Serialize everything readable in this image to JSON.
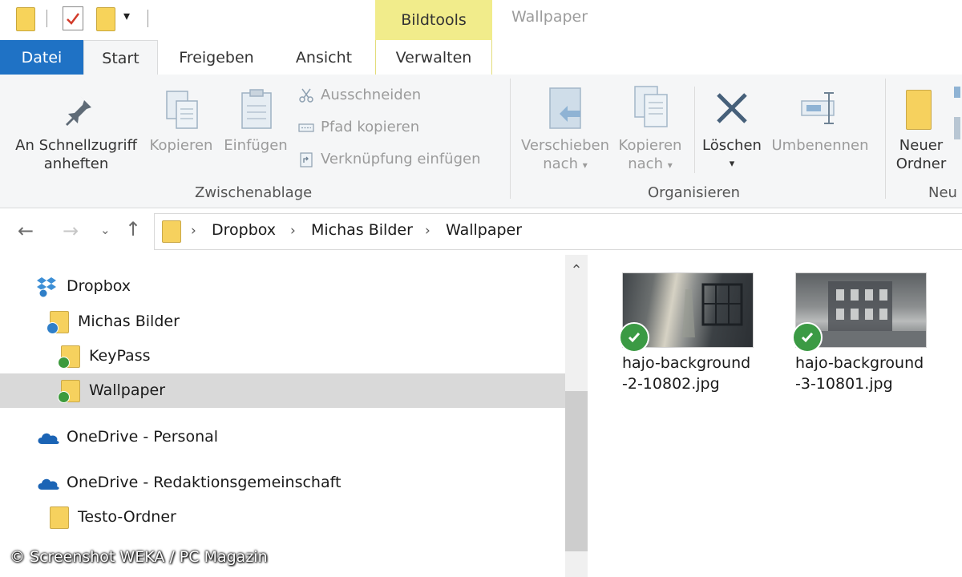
{
  "window": {
    "title": "Wallpaper",
    "context_group": "Bildtools"
  },
  "tabs": {
    "file": "Datei",
    "start": "Start",
    "share": "Freigeben",
    "view": "Ansicht",
    "manage": "Verwalten"
  },
  "ribbon": {
    "pin_line1": "An Schnellzugriff",
    "pin_line2": "anheften",
    "copy": "Kopieren",
    "paste": "Einfügen",
    "cut": "Ausschneiden",
    "copy_path": "Pfad kopieren",
    "paste_shortcut": "Verknüpfung einfügen",
    "group_clipboard": "Zwischenablage",
    "move_line1": "Verschieben",
    "move_line2": "nach",
    "copyto_line1": "Kopieren",
    "copyto_line2": "nach",
    "delete": "Löschen",
    "rename": "Umbenennen",
    "group_organize": "Organisieren",
    "newfolder_line1": "Neuer",
    "newfolder_line2": "Ordner",
    "group_new": "Neu"
  },
  "address": {
    "crumbs": [
      "Dropbox",
      "Michas Bilder",
      "Wallpaper"
    ]
  },
  "nav_tree": [
    {
      "label": "Dropbox"
    },
    {
      "label": "Michas Bilder"
    },
    {
      "label": "KeyPass"
    },
    {
      "label": "Wallpaper"
    },
    {
      "label": "OneDrive - Personal"
    },
    {
      "label": "OneDrive - Redaktionsgemeinschaft"
    },
    {
      "label": "Testo-Ordner"
    }
  ],
  "files": [
    {
      "line1": "hajo-background",
      "line2": "-2-10802.jpg"
    },
    {
      "line1": "hajo-background",
      "line2": "-3-10801.jpg"
    }
  ],
  "watermark": "© Screenshot WEKA / PC Magazin",
  "colors": {
    "file_tab": "#1f72c5",
    "context_tab": "#f1ec8b",
    "folder": "#f6d15e",
    "sync_ok": "#3b9a44"
  }
}
